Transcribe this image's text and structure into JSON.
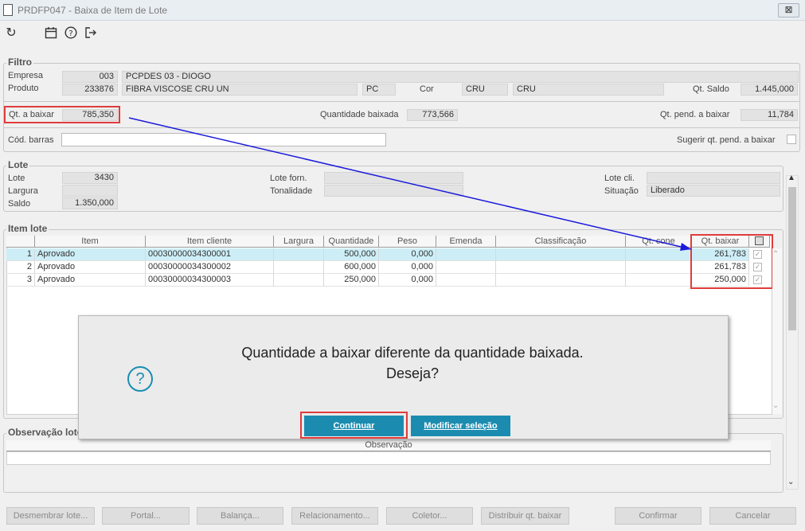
{
  "window": {
    "title": "PRDFP047 - Baixa de Item de Lote",
    "close_label": "⊠"
  },
  "toolbar": {
    "icons": [
      "refresh-icon",
      "calendar-icon",
      "help-icon",
      "exit-icon"
    ]
  },
  "filtro": {
    "group_label": "Filtro",
    "empresa_label": "Empresa",
    "empresa_code": "003",
    "empresa_name": "PCPDES 03 - DIOGO",
    "produto_label": "Produto",
    "produto_code": "233876",
    "produto_name": "FIBRA VISCOSE CRU UN",
    "unidade": "PC",
    "cor_label": "Cor",
    "cor_code": "CRU",
    "cor_name": "CRU",
    "qt_saldo_label": "Qt. Saldo",
    "qt_saldo": "1.445,000",
    "qt_baixar_label": "Qt. a baixar",
    "qt_baixar": "785,350",
    "qt_baixada_label": "Quantidade baixada",
    "qt_baixada": "773,566",
    "qt_pend_label": "Qt. pend. a baixar",
    "qt_pend": "11,784",
    "cod_barras_label": "Cód. barras",
    "cod_barras": "",
    "sugerir_label": "Sugerir qt. pend. a baixar"
  },
  "lote": {
    "group_label": "Lote",
    "lote_label": "Lote",
    "lote": "3430",
    "largura_label": "Largura",
    "largura": "",
    "saldo_label": "Saldo",
    "saldo": "1.350,000",
    "lote_forn_label": "Lote forn.",
    "lote_forn": "",
    "tonalidade_label": "Tonalidade",
    "tonalidade": "",
    "lote_cli_label": "Lote cli.",
    "lote_cli": "",
    "situacao_label": "Situação",
    "situacao": "Liberado"
  },
  "item_lote": {
    "group_label": "Item lote",
    "columns": [
      "Item",
      "Item cliente",
      "Largura",
      "Quantidade",
      "Peso",
      "Emenda",
      "Classificação",
      "Qt. cone",
      "Qt. baixar"
    ],
    "rows": [
      {
        "n": "1",
        "item": "Aprovado",
        "item_cliente": "00030000034300001",
        "largura": "",
        "quantidade": "500,000",
        "peso": "0,000",
        "emenda": "",
        "classificacao": "",
        "qt_cone": "",
        "qt_baixar": "261,783",
        "checked": true
      },
      {
        "n": "2",
        "item": "Aprovado",
        "item_cliente": "00030000034300002",
        "largura": "",
        "quantidade": "600,000",
        "peso": "0,000",
        "emenda": "",
        "classificacao": "",
        "qt_cone": "",
        "qt_baixar": "261,783",
        "checked": true
      },
      {
        "n": "3",
        "item": "Aprovado",
        "item_cliente": "00030000034300003",
        "largura": "",
        "quantidade": "250,000",
        "peso": "0,000",
        "emenda": "",
        "classificacao": "",
        "qt_cone": "",
        "qt_baixar": "250,000",
        "checked": true
      }
    ]
  },
  "observacao": {
    "group_label": "Observação lote",
    "column": "Observação"
  },
  "dialog": {
    "message_line1": "Quantidade a baixar diferente da quantidade baixada.",
    "message_line2": "Deseja?",
    "icon": "question-icon",
    "continuar_label": "Continuar",
    "modificar_label": "Modificar seleção"
  },
  "buttons": {
    "desmembrar": "Desmembrar lote...",
    "portal": "Portal...",
    "balanca": "Balança...",
    "relacionamento": "Relacionamento...",
    "coletor": "Coletor...",
    "distribuir": "Distribuir qt. baixar",
    "confirmar": "Confirmar",
    "cancelar": "Cancelar"
  },
  "colors": {
    "accent": "#1b8cb0",
    "highlight": "#e03c3c",
    "arrow": "#1a1adb",
    "selected_row": "#cdeef7"
  }
}
